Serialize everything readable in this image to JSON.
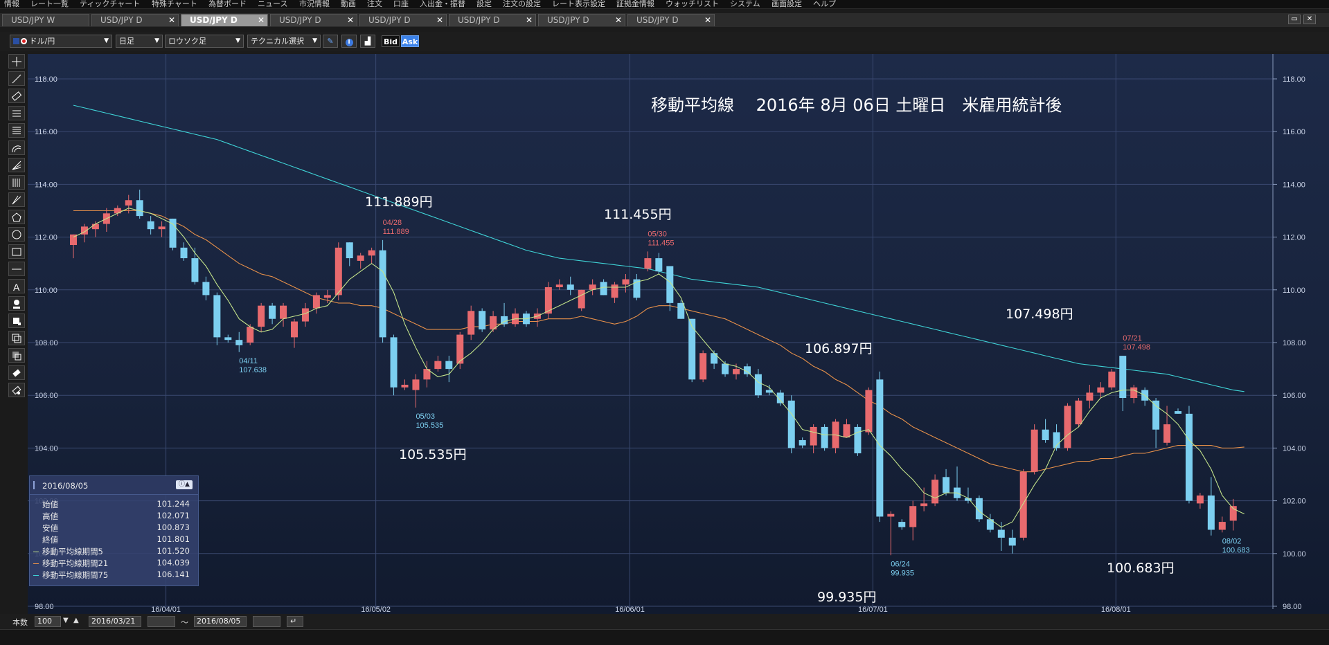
{
  "menubar": {
    "items": [
      "情報",
      "レート一覧",
      "ティックチャート",
      "特殊チャート",
      "為替ボード",
      "ニュース",
      "市況情報",
      "動画",
      "注文",
      "口座",
      "入出金・振替",
      "設定",
      "注文の設定",
      "レート表示設定",
      "証拠金情報",
      "ウォッチリスト",
      "システム",
      "画面設定",
      "ヘルプ"
    ]
  },
  "tabs": [
    {
      "label": "USD/JPY W",
      "active": false
    },
    {
      "label": "USD/JPY D",
      "active": false
    },
    {
      "label": "USD/JPY D",
      "active": true
    },
    {
      "label": "USD/JPY D",
      "active": false
    },
    {
      "label": "USD/JPY D",
      "active": false
    },
    {
      "label": "USD/JPY D",
      "active": false
    },
    {
      "label": "USD/JPY D",
      "active": false
    },
    {
      "label": "USD/JPY D",
      "active": false
    }
  ],
  "toolbar": {
    "pair": "ドル/円",
    "period": "日足",
    "chart_type": "ロウソク足",
    "technical": "テクニカル選択",
    "bid_label": "Bid",
    "ask_label": "Ask"
  },
  "chart_data": {
    "type": "candlestick",
    "y_ticks": [
      "118.00",
      "116.00",
      "114.00",
      "112.00",
      "110.00",
      "108.00",
      "106.00",
      "104.00",
      "102.00",
      "100.00",
      "98.00"
    ],
    "x_ticks": [
      "16/04/01",
      "16/05/02",
      "16/06/01",
      "16/07/01",
      "16/08/01"
    ],
    "ylim": [
      98,
      118.3
    ],
    "title": "移動平均線　 2016年 8月 06日 土曜日　米雇用統計後",
    "colors": {
      "up": "#e86a6e",
      "down": "#7ccff0",
      "ma5": "#c3e38a",
      "ma21": "#e8914a",
      "ma75": "#3fd3d6"
    },
    "candles": [
      {
        "o": 111.7,
        "h": 112.1,
        "l": 111.2,
        "c": 112.1
      },
      {
        "o": 112.1,
        "h": 112.5,
        "l": 111.8,
        "c": 112.4
      },
      {
        "o": 112.3,
        "h": 112.6,
        "l": 112.0,
        "c": 112.5
      },
      {
        "o": 112.5,
        "h": 113.1,
        "l": 112.2,
        "c": 112.9
      },
      {
        "o": 112.9,
        "h": 113.2,
        "l": 112.8,
        "c": 113.1
      },
      {
        "o": 113.2,
        "h": 113.6,
        "l": 112.9,
        "c": 113.4
      },
      {
        "o": 113.4,
        "h": 113.8,
        "l": 112.7,
        "c": 112.8
      },
      {
        "o": 112.6,
        "h": 112.8,
        "l": 112.1,
        "c": 112.3
      },
      {
        "o": 112.3,
        "h": 112.6,
        "l": 112.0,
        "c": 112.4
      },
      {
        "o": 112.7,
        "h": 112.7,
        "l": 111.5,
        "c": 111.6
      },
      {
        "o": 111.6,
        "h": 111.8,
        "l": 111.1,
        "c": 111.2
      },
      {
        "o": 111.2,
        "h": 111.6,
        "l": 110.2,
        "c": 110.3
      },
      {
        "o": 110.3,
        "h": 110.5,
        "l": 109.6,
        "c": 109.8
      },
      {
        "o": 109.8,
        "h": 109.9,
        "l": 107.9,
        "c": 108.2
      },
      {
        "o": 108.2,
        "h": 108.3,
        "l": 108.0,
        "c": 108.1
      },
      {
        "o": 108.1,
        "h": 108.4,
        "l": 107.638,
        "c": 107.9
      },
      {
        "o": 108.0,
        "h": 108.7,
        "l": 107.9,
        "c": 108.6
      },
      {
        "o": 108.6,
        "h": 109.5,
        "l": 108.4,
        "c": 109.4
      },
      {
        "o": 109.4,
        "h": 109.5,
        "l": 108.7,
        "c": 108.9
      },
      {
        "o": 108.9,
        "h": 109.5,
        "l": 108.6,
        "c": 109.4
      },
      {
        "o": 108.2,
        "h": 108.9,
        "l": 107.8,
        "c": 108.8
      },
      {
        "o": 108.8,
        "h": 109.5,
        "l": 108.6,
        "c": 109.3
      },
      {
        "o": 109.3,
        "h": 109.9,
        "l": 109.1,
        "c": 109.8
      },
      {
        "o": 109.7,
        "h": 110.0,
        "l": 109.5,
        "c": 109.8
      },
      {
        "o": 109.8,
        "h": 111.8,
        "l": 109.6,
        "c": 111.6
      },
      {
        "o": 111.8,
        "h": 111.8,
        "l": 110.9,
        "c": 111.2
      },
      {
        "o": 111.1,
        "h": 111.4,
        "l": 110.8,
        "c": 111.3
      },
      {
        "o": 111.3,
        "h": 111.6,
        "l": 111.0,
        "c": 111.5
      },
      {
        "o": 111.5,
        "h": 111.889,
        "l": 108.0,
        "c": 108.2
      },
      {
        "o": 108.2,
        "h": 108.3,
        "l": 106.0,
        "c": 106.3
      },
      {
        "o": 106.3,
        "h": 106.6,
        "l": 106.2,
        "c": 106.4
      },
      {
        "o": 106.2,
        "h": 106.8,
        "l": 105.535,
        "c": 106.6
      },
      {
        "o": 106.6,
        "h": 107.3,
        "l": 106.3,
        "c": 107.0
      },
      {
        "o": 107.0,
        "h": 107.5,
        "l": 106.9,
        "c": 107.3
      },
      {
        "o": 107.3,
        "h": 107.5,
        "l": 106.5,
        "c": 107.0
      },
      {
        "o": 107.2,
        "h": 108.4,
        "l": 107.0,
        "c": 108.3
      },
      {
        "o": 108.3,
        "h": 109.4,
        "l": 108.1,
        "c": 109.2
      },
      {
        "o": 109.2,
        "h": 109.3,
        "l": 108.4,
        "c": 108.5
      },
      {
        "o": 108.5,
        "h": 109.2,
        "l": 108.4,
        "c": 109.0
      },
      {
        "o": 109.0,
        "h": 109.5,
        "l": 108.6,
        "c": 108.7
      },
      {
        "o": 108.7,
        "h": 109.3,
        "l": 108.6,
        "c": 109.1
      },
      {
        "o": 109.1,
        "h": 109.2,
        "l": 108.6,
        "c": 108.7
      },
      {
        "o": 108.9,
        "h": 109.3,
        "l": 108.6,
        "c": 109.1
      },
      {
        "o": 109.1,
        "h": 110.3,
        "l": 108.9,
        "c": 110.1
      },
      {
        "o": 110.1,
        "h": 110.4,
        "l": 110.0,
        "c": 110.2
      },
      {
        "o": 110.2,
        "h": 110.5,
        "l": 109.8,
        "c": 110.0
      },
      {
        "o": 109.3,
        "h": 110.0,
        "l": 109.2,
        "c": 110.0
      },
      {
        "o": 110.0,
        "h": 110.4,
        "l": 109.8,
        "c": 110.2
      },
      {
        "o": 110.3,
        "h": 110.4,
        "l": 109.8,
        "c": 109.8
      },
      {
        "o": 109.7,
        "h": 110.3,
        "l": 109.5,
        "c": 110.2
      },
      {
        "o": 110.2,
        "h": 110.6,
        "l": 109.9,
        "c": 110.4
      },
      {
        "o": 110.4,
        "h": 110.6,
        "l": 109.6,
        "c": 109.7
      },
      {
        "o": 110.8,
        "h": 111.455,
        "l": 110.7,
        "c": 111.2
      },
      {
        "o": 111.2,
        "h": 111.4,
        "l": 110.6,
        "c": 110.7
      },
      {
        "o": 110.9,
        "h": 110.9,
        "l": 109.2,
        "c": 109.5
      },
      {
        "o": 109.5,
        "h": 109.6,
        "l": 108.9,
        "c": 108.9
      },
      {
        "o": 108.9,
        "h": 108.9,
        "l": 106.5,
        "c": 106.6
      },
      {
        "o": 106.6,
        "h": 107.7,
        "l": 106.5,
        "c": 107.6
      },
      {
        "o": 107.6,
        "h": 107.7,
        "l": 107.0,
        "c": 107.2
      },
      {
        "o": 107.2,
        "h": 107.3,
        "l": 106.7,
        "c": 106.8
      },
      {
        "o": 106.8,
        "h": 107.2,
        "l": 106.6,
        "c": 107.0
      },
      {
        "o": 107.1,
        "h": 107.2,
        "l": 106.7,
        "c": 106.8
      },
      {
        "o": 106.8,
        "h": 107.0,
        "l": 105.9,
        "c": 106.0
      },
      {
        "o": 106.2,
        "h": 106.4,
        "l": 106.0,
        "c": 106.1
      },
      {
        "o": 106.1,
        "h": 106.2,
        "l": 105.6,
        "c": 105.7
      },
      {
        "o": 105.8,
        "h": 106.0,
        "l": 103.8,
        "c": 104.0
      },
      {
        "o": 104.3,
        "h": 104.4,
        "l": 104.0,
        "c": 104.1
      },
      {
        "o": 104.1,
        "h": 104.9,
        "l": 103.8,
        "c": 104.8
      },
      {
        "o": 104.8,
        "h": 104.9,
        "l": 103.9,
        "c": 104.0
      },
      {
        "o": 104.0,
        "h": 105.1,
        "l": 103.8,
        "c": 105.0
      },
      {
        "o": 104.4,
        "h": 105.1,
        "l": 104.4,
        "c": 104.9
      },
      {
        "o": 104.8,
        "h": 104.9,
        "l": 103.7,
        "c": 103.8
      },
      {
        "o": 104.6,
        "h": 106.3,
        "l": 104.5,
        "c": 106.2
      },
      {
        "o": 106.6,
        "h": 106.9,
        "l": 101.2,
        "c": 101.4
      },
      {
        "o": 101.4,
        "h": 101.6,
        "l": 99.935,
        "c": 101.5
      },
      {
        "o": 101.2,
        "h": 101.3,
        "l": 100.9,
        "c": 101.0
      },
      {
        "o": 101.0,
        "h": 102.0,
        "l": 100.5,
        "c": 101.8
      },
      {
        "o": 101.8,
        "h": 102.5,
        "l": 101.6,
        "c": 101.9
      },
      {
        "o": 101.9,
        "h": 103.0,
        "l": 101.8,
        "c": 102.8
      },
      {
        "o": 102.9,
        "h": 103.2,
        "l": 102.2,
        "c": 102.3
      },
      {
        "o": 102.5,
        "h": 103.3,
        "l": 102.0,
        "c": 102.1
      },
      {
        "o": 102.1,
        "h": 102.5,
        "l": 101.9,
        "c": 102.0
      },
      {
        "o": 102.1,
        "h": 102.2,
        "l": 101.2,
        "c": 101.3
      },
      {
        "o": 101.3,
        "h": 101.5,
        "l": 100.8,
        "c": 100.9
      },
      {
        "o": 100.9,
        "h": 101.2,
        "l": 100.1,
        "c": 100.6
      },
      {
        "o": 100.6,
        "h": 100.9,
        "l": 100.0,
        "c": 100.3
      },
      {
        "o": 100.6,
        "h": 103.2,
        "l": 100.5,
        "c": 103.1
      },
      {
        "o": 103.1,
        "h": 104.9,
        "l": 103.0,
        "c": 104.7
      },
      {
        "o": 104.7,
        "h": 105.1,
        "l": 104.2,
        "c": 104.3
      },
      {
        "o": 104.6,
        "h": 104.9,
        "l": 103.9,
        "c": 104.0
      },
      {
        "o": 104.0,
        "h": 105.7,
        "l": 103.9,
        "c": 105.6
      },
      {
        "o": 104.9,
        "h": 105.9,
        "l": 104.8,
        "c": 105.8
      },
      {
        "o": 105.8,
        "h": 106.4,
        "l": 105.5,
        "c": 106.1
      },
      {
        "o": 106.1,
        "h": 106.5,
        "l": 105.9,
        "c": 106.3
      },
      {
        "o": 106.3,
        "h": 107.0,
        "l": 106.2,
        "c": 106.9
      },
      {
        "o": 107.498,
        "h": 107.498,
        "l": 105.4,
        "c": 105.9
      },
      {
        "o": 105.9,
        "h": 106.4,
        "l": 105.7,
        "c": 106.3
      },
      {
        "o": 106.2,
        "h": 106.3,
        "l": 105.6,
        "c": 105.8
      },
      {
        "o": 105.8,
        "h": 105.9,
        "l": 104.0,
        "c": 104.7
      },
      {
        "o": 104.2,
        "h": 105.6,
        "l": 104.1,
        "c": 104.9
      },
      {
        "o": 105.4,
        "h": 105.5,
        "l": 105.3,
        "c": 105.3
      },
      {
        "o": 105.3,
        "h": 105.6,
        "l": 101.9,
        "c": 102.0
      },
      {
        "o": 101.9,
        "h": 102.3,
        "l": 101.7,
        "c": 102.2
      },
      {
        "o": 102.2,
        "h": 102.9,
        "l": 100.683,
        "c": 100.9
      },
      {
        "o": 100.9,
        "h": 101.4,
        "l": 100.8,
        "c": 101.2
      },
      {
        "o": 101.244,
        "h": 102.071,
        "l": 100.873,
        "c": 101.801
      }
    ],
    "ma5": [
      112.0,
      112.2,
      112.5,
      112.7,
      112.9,
      113.1,
      113.0,
      112.9,
      112.7,
      112.5,
      112.0,
      111.4,
      110.9,
      110.2,
      109.6,
      108.9,
      108.6,
      108.4,
      108.5,
      108.9,
      109.0,
      109.1,
      109.3,
      109.4,
      109.9,
      110.4,
      110.7,
      111.0,
      110.7,
      109.9,
      108.7,
      107.8,
      107.0,
      106.7,
      106.8,
      107.3,
      107.6,
      108.0,
      108.5,
      108.8,
      108.9,
      108.9,
      109.0,
      109.2,
      109.4,
      109.6,
      109.8,
      110.0,
      110.1,
      110.1,
      110.1,
      110.3,
      110.4,
      110.6,
      110.3,
      109.7,
      108.6,
      108.1,
      107.6,
      107.2,
      107.1,
      106.9,
      106.5,
      106.3,
      105.8,
      105.3,
      104.7,
      104.6,
      104.5,
      104.5,
      104.4,
      104.6,
      104.7,
      104.1,
      103.7,
      103.2,
      102.8,
      102.3,
      102.1,
      102.3,
      102.3,
      102.1,
      101.6,
      101.3,
      101.0,
      101.2,
      101.9,
      102.6,
      103.2,
      104.1,
      104.5,
      104.8,
      105.4,
      105.9,
      106.1,
      106.2,
      106.2,
      106.0,
      105.6,
      105.3,
      104.9,
      104.3,
      103.9,
      103.2,
      102.2,
      101.7,
      101.5
    ],
    "ma21": [
      113.0,
      113.0,
      113.0,
      113.0,
      113.0,
      113.0,
      113.0,
      112.9,
      112.8,
      112.6,
      112.4,
      112.1,
      111.9,
      111.6,
      111.3,
      111.0,
      110.8,
      110.6,
      110.5,
      110.3,
      110.1,
      109.9,
      109.7,
      109.6,
      109.5,
      109.5,
      109.4,
      109.4,
      109.3,
      109.1,
      108.9,
      108.7,
      108.5,
      108.5,
      108.5,
      108.5,
      108.6,
      108.6,
      108.7,
      108.7,
      108.8,
      108.8,
      108.8,
      108.9,
      108.9,
      108.9,
      109.0,
      108.9,
      108.8,
      108.7,
      108.8,
      109.0,
      109.3,
      109.4,
      109.4,
      109.3,
      109.2,
      109.1,
      109.0,
      108.9,
      108.7,
      108.5,
      108.3,
      108.1,
      107.9,
      107.6,
      107.4,
      107.1,
      106.9,
      106.6,
      106.4,
      106.1,
      105.8,
      105.6,
      105.3,
      105.1,
      104.8,
      104.6,
      104.4,
      104.2,
      104.0,
      103.8,
      103.6,
      103.4,
      103.3,
      103.2,
      103.1,
      103.1,
      103.2,
      103.3,
      103.4,
      103.5,
      103.5,
      103.6,
      103.6,
      103.7,
      103.8,
      103.8,
      103.9,
      104.0,
      104.1,
      104.1,
      104.1,
      104.1,
      104.0,
      104.0,
      104.039
    ],
    "ma75": [
      117.0,
      116.9,
      116.8,
      116.7,
      116.6,
      116.5,
      116.4,
      116.3,
      116.2,
      116.1,
      116.0,
      115.9,
      115.8,
      115.7,
      115.55,
      115.4,
      115.25,
      115.1,
      114.95,
      114.8,
      114.65,
      114.5,
      114.35,
      114.2,
      114.05,
      113.9,
      113.75,
      113.6,
      113.45,
      113.3,
      113.15,
      113.0,
      112.85,
      112.7,
      112.55,
      112.4,
      112.25,
      112.1,
      111.95,
      111.8,
      111.65,
      111.5,
      111.4,
      111.3,
      111.2,
      111.15,
      111.1,
      111.05,
      111.0,
      110.95,
      110.9,
      110.85,
      110.8,
      110.7,
      110.6,
      110.5,
      110.4,
      110.35,
      110.3,
      110.25,
      110.2,
      110.15,
      110.1,
      110.0,
      109.9,
      109.8,
      109.7,
      109.6,
      109.5,
      109.4,
      109.3,
      109.2,
      109.1,
      109.0,
      108.9,
      108.8,
      108.7,
      108.6,
      108.5,
      108.4,
      108.3,
      108.2,
      108.1,
      108.0,
      107.9,
      107.8,
      107.7,
      107.6,
      107.5,
      107.4,
      107.3,
      107.2,
      107.15,
      107.1,
      107.05,
      107.0,
      106.95,
      106.9,
      106.85,
      106.8,
      106.7,
      106.6,
      106.5,
      106.4,
      106.3,
      106.2,
      106.141
    ],
    "small_labels": [
      {
        "i": 15,
        "date": "04/11",
        "value": "107.638",
        "pos": "low",
        "color": "#7ccff0"
      },
      {
        "i": 28,
        "date": "04/28",
        "value": "111.889",
        "pos": "high",
        "color": "#e86a6e"
      },
      {
        "i": 31,
        "date": "05/03",
        "value": "105.535",
        "pos": "low",
        "color": "#7ccff0"
      },
      {
        "i": 52,
        "date": "05/30",
        "value": "111.455",
        "pos": "high",
        "color": "#e86a6e"
      },
      {
        "i": 74,
        "date": "06/24",
        "value": "99.935",
        "pos": "low",
        "color": "#7ccff0"
      },
      {
        "i": 95,
        "date": "07/21",
        "value": "107.498",
        "pos": "high",
        "color": "#e86a6e"
      },
      {
        "i": 104,
        "date": "08/02",
        "value": "100.683",
        "pos": "low",
        "color": "#7ccff0"
      }
    ],
    "annotations": [
      "111.889円",
      "111.455円",
      "105.535円",
      "106.897円",
      "107.498円",
      "99.935円",
      "100.683円"
    ]
  },
  "info": {
    "date": "2016/08/05",
    "rows": [
      {
        "label": "始値",
        "value": "101.244"
      },
      {
        "label": "高値",
        "value": "102.071"
      },
      {
        "label": "安値",
        "value": "100.873"
      },
      {
        "label": "終値",
        "value": "101.801"
      },
      {
        "label": "移動平均線期間5",
        "value": "101.520",
        "color": "#c3e38a"
      },
      {
        "label": "移動平均線期間21",
        "value": "104.039",
        "color": "#e8914a"
      },
      {
        "label": "移動平均線期間75",
        "value": "106.141",
        "color": "#3fd3d6"
      }
    ]
  },
  "bottombar": {
    "count_label": "本数",
    "count_value": "100",
    "from_date": "2016/03/21",
    "tilde": "～",
    "to_date": "2016/08/05"
  }
}
